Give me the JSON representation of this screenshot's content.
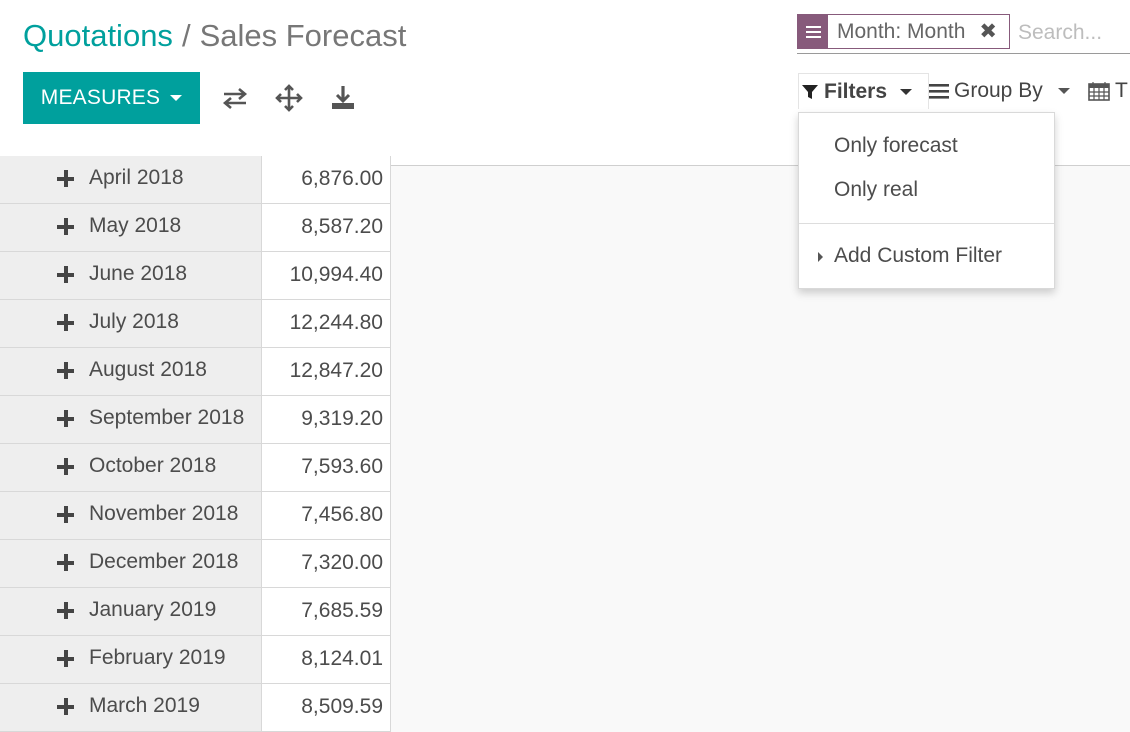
{
  "breadcrumb": {
    "parent": "Quotations",
    "separator": "/",
    "current": "Sales Forecast"
  },
  "toolbar": {
    "measures_label": "MEASURES",
    "icons": [
      "flip-axis-icon",
      "expand-all-icon",
      "download-icon"
    ]
  },
  "search": {
    "facet_label": "Month: Month",
    "facet_remove": "✖",
    "placeholder": "Search..."
  },
  "search_options": {
    "filters_label": "Filters",
    "groupby_label": "Group By",
    "favorites_label": "T"
  },
  "filters_dropdown": {
    "items": [
      "Only forecast",
      "Only real"
    ],
    "custom_filter": "Add Custom Filter"
  },
  "pivot": {
    "rows": [
      {
        "label": "April 2018",
        "value": "6,876.00"
      },
      {
        "label": "May 2018",
        "value": "8,587.20"
      },
      {
        "label": "June 2018",
        "value": "10,994.40"
      },
      {
        "label": "July 2018",
        "value": "12,244.80"
      },
      {
        "label": "August 2018",
        "value": "12,847.20"
      },
      {
        "label": "September 2018",
        "value": "9,319.20"
      },
      {
        "label": "October 2018",
        "value": "7,593.60"
      },
      {
        "label": "November 2018",
        "value": "7,456.80"
      },
      {
        "label": "December 2018",
        "value": "7,320.00"
      },
      {
        "label": "January 2019",
        "value": "7,685.59"
      },
      {
        "label": "February 2019",
        "value": "8,124.01"
      },
      {
        "label": "March 2019",
        "value": "8,509.59"
      }
    ]
  },
  "colors": {
    "primary": "#00a09d",
    "facet": "#875a7b",
    "header_bg": "#eeeeee"
  }
}
